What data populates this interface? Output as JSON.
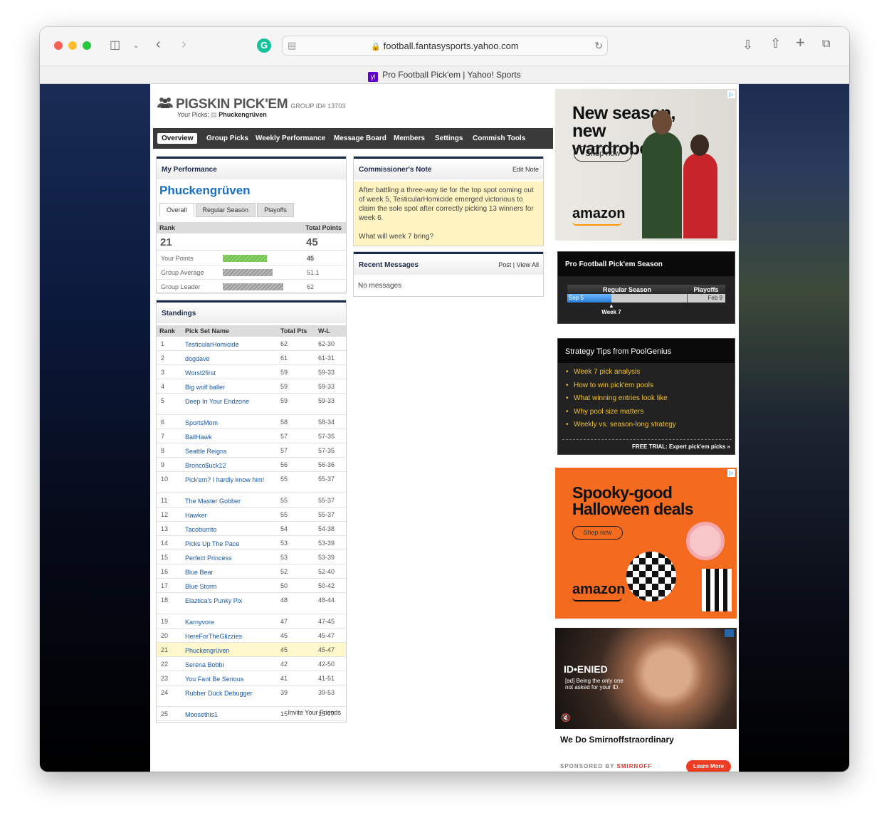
{
  "browser": {
    "url": "football.fantasysports.yahoo.com",
    "tab_title": "Pro Football Pick'em | Yahoo! Sports",
    "favicon_text": "y!"
  },
  "header": {
    "title": "PIGSKIN PICK'EM",
    "group_id": "GROUP ID# 13703",
    "your_picks_label": "Your Picks:",
    "your_picks_name": "Phuckengrüven"
  },
  "nav": {
    "items": [
      "Overview",
      "Group Picks",
      "Weekly Performance",
      "Message Board",
      "Members",
      "Settings",
      "Commish Tools"
    ],
    "active": "Overview"
  },
  "performance": {
    "heading": "My Performance",
    "team_name": "Phuckengrüven",
    "tabs": [
      "Overall",
      "Regular Season",
      "Playoffs"
    ],
    "rank_label": "Rank",
    "total_points_label": "Total Points",
    "rank": "21",
    "total_points": "45",
    "rows": [
      {
        "label": "Your Points",
        "value": "45",
        "numeric": 45
      },
      {
        "label": "Group Average",
        "value": "51.1",
        "numeric": 51.1
      },
      {
        "label": "Group Leader",
        "value": "62",
        "numeric": 62
      }
    ]
  },
  "standings": {
    "heading": "Standings",
    "columns": [
      "Rank",
      "Pick Set Name",
      "Total Pts",
      "W-L"
    ],
    "rows": [
      {
        "rank": "1",
        "name": "TesticularHomicide",
        "pts": "62",
        "wl": "62-30"
      },
      {
        "rank": "2",
        "name": "dogdave",
        "pts": "61",
        "wl": "61-31"
      },
      {
        "rank": "3",
        "name": "Worst2first",
        "pts": "59",
        "wl": "59-33"
      },
      {
        "rank": "4",
        "name": "Big wolf baller",
        "pts": "59",
        "wl": "59-33"
      },
      {
        "rank": "5",
        "name": "Deep In Your Endzone",
        "pts": "59",
        "wl": "59-33"
      },
      {
        "rank": "6",
        "name": "SportsMom",
        "pts": "58",
        "wl": "58-34"
      },
      {
        "rank": "7",
        "name": "BallHawk",
        "pts": "57",
        "wl": "57-35"
      },
      {
        "rank": "8",
        "name": "Seattle Reigns",
        "pts": "57",
        "wl": "57-35"
      },
      {
        "rank": "9",
        "name": "Bronco$uck12",
        "pts": "56",
        "wl": "56-36"
      },
      {
        "rank": "10",
        "name": "Pick'em? I hardly know him!",
        "pts": "55",
        "wl": "55-37"
      },
      {
        "rank": "11",
        "name": "The Master Gobber",
        "pts": "55",
        "wl": "55-37"
      },
      {
        "rank": "12",
        "name": "Hawker",
        "pts": "55",
        "wl": "55-37"
      },
      {
        "rank": "13",
        "name": "Tacoburrito",
        "pts": "54",
        "wl": "54-38"
      },
      {
        "rank": "14",
        "name": "Picks Up The Pace",
        "pts": "53",
        "wl": "53-39"
      },
      {
        "rank": "15",
        "name": "Perfect Princess",
        "pts": "53",
        "wl": "53-39"
      },
      {
        "rank": "16",
        "name": "Blue Bear",
        "pts": "52",
        "wl": "52-40"
      },
      {
        "rank": "17",
        "name": "Blue Storm",
        "pts": "50",
        "wl": "50-42"
      },
      {
        "rank": "18",
        "name": "Elaztica's Punky Pix",
        "pts": "48",
        "wl": "48-44"
      },
      {
        "rank": "19",
        "name": "Karnyvore",
        "pts": "47",
        "wl": "47-45"
      },
      {
        "rank": "20",
        "name": "HereForTheGlizzies",
        "pts": "45",
        "wl": "45-47"
      },
      {
        "rank": "21",
        "name": "Phuckengrüven",
        "pts": "45",
        "wl": "45-47"
      },
      {
        "rank": "22",
        "name": "Serena Bobbi",
        "pts": "42",
        "wl": "42-50"
      },
      {
        "rank": "23",
        "name": "You Fant Be Serious",
        "pts": "41",
        "wl": "41-51"
      },
      {
        "rank": "24",
        "name": "Rubber Duck Debugger",
        "pts": "39",
        "wl": "39-53"
      },
      {
        "rank": "25",
        "name": "Moosethis1",
        "pts": "15",
        "wl": "15-77"
      }
    ],
    "invite_link": "Invite Your Friends"
  },
  "commissioner_note": {
    "heading": "Commissioner's Note",
    "edit_link": "Edit Note",
    "body": "After battling a three-way tie for the top spot coming out of week 5, TesticularHomicide emerged victorious to claim the sole spot after correctly picking 13 winners for week 6.",
    "question": "What will week 7 bring?"
  },
  "recent_messages": {
    "heading": "Recent Messages",
    "post_link": "Post",
    "view_all_link": "View All",
    "empty_text": "No messages"
  },
  "season": {
    "heading": "Pro Football Pick'em Season",
    "regular_label": "Regular Season",
    "playoffs_label": "Playoffs",
    "start": "Sep 5",
    "end": "Feb 9",
    "current": "Week 7"
  },
  "strategy": {
    "heading": "Strategy Tips from PoolGenius",
    "tips": [
      "Week 7 pick analysis",
      "How to win pick'em pools",
      "What winning entries look like",
      "Why pool size matters",
      "Weekly vs. season-long strategy"
    ],
    "cta": "FREE TRIAL: Expert pick'em picks »"
  },
  "ads": {
    "ad1_headline": "New season, new wardrobe",
    "ad1_button": "Shop now",
    "ad1_brand": "amazon",
    "ad2_headline": "Spooky-good Halloween deals",
    "ad2_button": "Shop now",
    "ad2_brand": "amazon",
    "ad3_logo": "ID•ENIED",
    "ad3_caption": "[ad] Being the only one not asked for your ID.",
    "ad3_title": "We Do Smirnoffstraordinary",
    "ad3_sponsor_label": "SPONSORED BY",
    "ad3_sponsor": "SMIRNOFF",
    "ad3_button": "Learn More"
  },
  "colors": {
    "nav_bg": "#3a3a3a",
    "link": "#1a5aa8",
    "header_navy": "#1d2b4a",
    "amazon_bg1": "#e9e7e2",
    "amazon_bg2": "#f46a1f",
    "tips_yellow": "#f1c232"
  }
}
